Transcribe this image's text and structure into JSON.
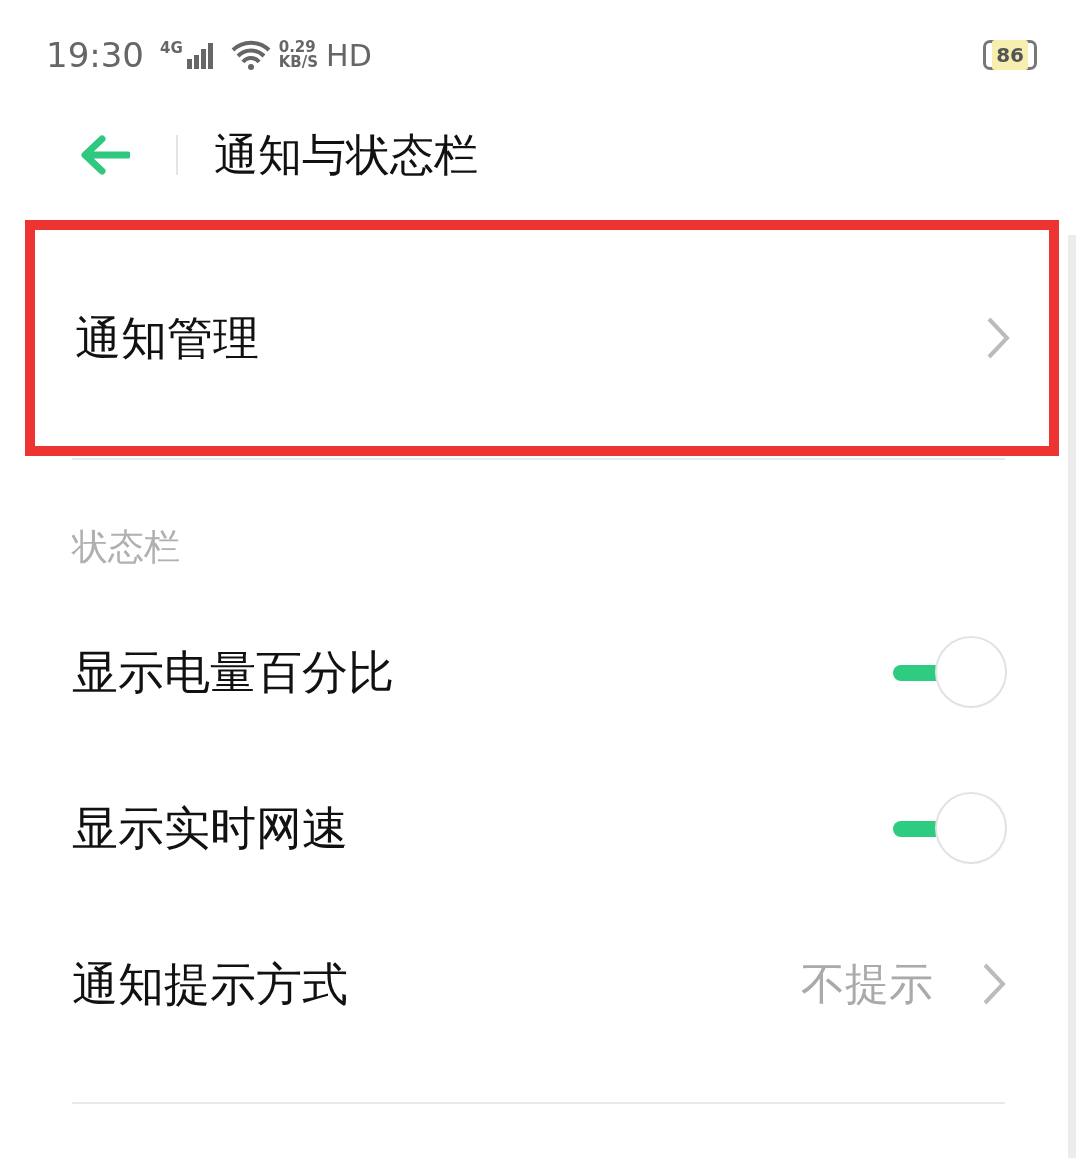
{
  "status_bar": {
    "time": "19:30",
    "network": "4G",
    "speed": "0.29",
    "speed_unit": "KB/S",
    "hd": "HD",
    "battery": "86"
  },
  "header": {
    "title": "通知与状态栏"
  },
  "rows": [
    {
      "kind": "link",
      "label": "通知管理",
      "highlighted": true
    },
    {
      "kind": "section",
      "label": "状态栏"
    },
    {
      "kind": "toggle",
      "label": "显示电量百分比",
      "on": true
    },
    {
      "kind": "toggle",
      "label": "显示实时网速",
      "on": true
    },
    {
      "kind": "link",
      "label": "通知提示方式",
      "value": "不提示"
    }
  ]
}
